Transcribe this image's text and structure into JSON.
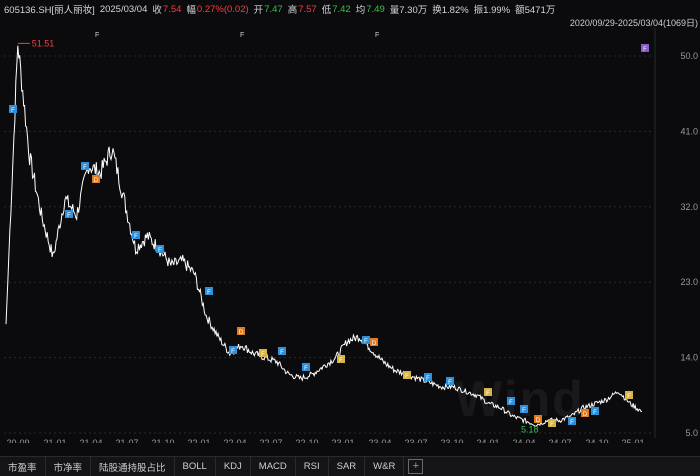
{
  "header": {
    "ticker": "605136.SH[丽人丽妆]",
    "date": "2025/03/04",
    "close_label": "收",
    "close_value": "7.54",
    "change_label": "幅",
    "change_value": "0.27%(0.02)",
    "open_label": "开",
    "open_value": "7.47",
    "high_label": "高",
    "high_value": "7.57",
    "low_label": "低",
    "low_value": "7.42",
    "avg_label": "均",
    "avg_value": "7.49",
    "volume": "量7.30万",
    "turnover": "换1.82%",
    "amplitude": "振1.99%",
    "amount": "额5471万"
  },
  "date_range": "2020/09/29-2025/03/04(1069日)",
  "y_axis_labels": [
    "50.0",
    "41.0",
    "32.0",
    "23.0",
    "14.0",
    "5.0"
  ],
  "x_axis_labels": [
    "20-09",
    "21-01",
    "21-04",
    "21-07",
    "21-10",
    "22-01",
    "22-04",
    "22-07",
    "22-10",
    "23-01",
    "23-04",
    "23-07",
    "23-10",
    "24-01",
    "24-04",
    "24-07",
    "24-10",
    "25-01"
  ],
  "annotations": {
    "max_label": "51.51",
    "min_label": "5.18"
  },
  "markers": {
    "F_label": "F",
    "D_label": "D"
  },
  "colors": {
    "line": "#ffffff",
    "marker_F": "#2f8fd8",
    "marker_D": "#e07b20",
    "marker_y": "#d8b24a",
    "marker_purple": "#8a5cc8",
    "max_color": "#f04040",
    "min_color": "#35c24a"
  },
  "indicator_tabs": [
    "市盈率",
    "市净率",
    "陆股通持股占比",
    "BOLL",
    "KDJ",
    "MACD",
    "RSI",
    "SAR",
    "W&R"
  ],
  "watermark": "Wind",
  "chart_data": {
    "type": "line",
    "x": [
      "2020-09",
      "2020-10",
      "2020-11",
      "2020-12",
      "2021-01",
      "2021-02",
      "2021-03",
      "2021-04",
      "2021-05",
      "2021-06",
      "2021-07",
      "2021-08",
      "2021-09",
      "2021-10",
      "2021-11",
      "2021-12",
      "2022-01",
      "2022-02",
      "2022-03",
      "2022-04",
      "2022-05",
      "2022-06",
      "2022-07",
      "2022-08",
      "2022-09",
      "2022-10",
      "2022-11",
      "2022-12",
      "2023-01",
      "2023-02",
      "2023-03",
      "2023-04",
      "2023-05",
      "2023-06",
      "2023-07",
      "2023-08",
      "2023-09",
      "2023-10",
      "2023-11",
      "2023-12",
      "2024-01",
      "2024-02",
      "2024-03",
      "2024-04",
      "2024-05",
      "2024-06",
      "2024-07",
      "2024-08",
      "2024-09",
      "2024-10",
      "2024-11",
      "2024-12",
      "2025-01",
      "2025-02",
      "2025-03"
    ],
    "values": [
      18.0,
      51.5,
      38.0,
      31.0,
      26.0,
      33.0,
      31.0,
      37.0,
      36.0,
      39.0,
      33.0,
      27.0,
      28.5,
      27.0,
      25.0,
      25.5,
      24.0,
      19.0,
      16.5,
      14.5,
      15.5,
      14.5,
      14.0,
      13.5,
      12.0,
      11.5,
      12.0,
      13.0,
      14.0,
      16.0,
      16.5,
      15.0,
      13.5,
      12.5,
      12.0,
      11.5,
      11.0,
      10.5,
      10.5,
      10.0,
      9.5,
      8.5,
      8.0,
      7.0,
      6.5,
      6.0,
      6.5,
      6.5,
      7.0,
      8.0,
      8.5,
      9.0,
      10.0,
      8.5,
      7.54
    ],
    "ylim": [
      0,
      52
    ],
    "y_ticks": [
      50,
      41,
      32,
      23,
      14,
      5
    ],
    "max": 51.51,
    "min": 5.18,
    "grid": true
  }
}
